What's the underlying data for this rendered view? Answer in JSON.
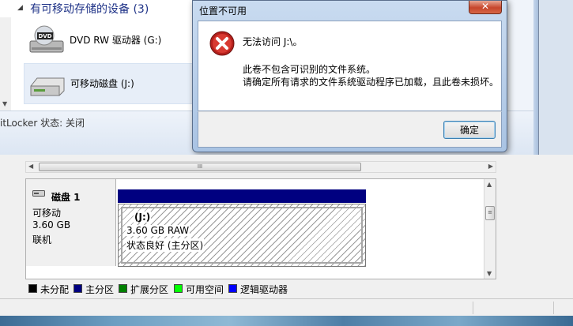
{
  "explorer": {
    "devices_section_title": "有可移动存储的设备 (3)",
    "drives": [
      {
        "label": "DVD RW 驱动器 (G:)",
        "icon": "dvd-drive-icon"
      },
      {
        "label": "可移动磁盘 (J:)",
        "icon": "removable-disk-icon"
      }
    ],
    "details_text": "itLocker 状态: 关闭"
  },
  "dialog": {
    "title": "位置不可用",
    "close_label": "✕",
    "icon": "error-icon",
    "message_title": "无法访问 J:\\。",
    "message_line1": "此卷不包含可识别的文件系统。",
    "message_line2": "请确定所有请求的文件系统驱动程序已加载，且此卷未损坏。",
    "ok_label": "确定"
  },
  "disk": {
    "name": "磁盘 1",
    "type": "可移动",
    "size": "3.60 GB",
    "status": "联机",
    "partition": {
      "letter": "(J:)",
      "size_fs": "3.60 GB RAW",
      "status": "状态良好 (主分区)"
    }
  },
  "hscroll_thumb_label": "III",
  "vscroll_thumb_label": "≡",
  "legend": [
    {
      "label": "未分配",
      "color": "#000000"
    },
    {
      "label": "主分区",
      "color": "#000080"
    },
    {
      "label": "扩展分区",
      "color": "#008000"
    },
    {
      "label": "可用空间",
      "color": "#00ff00"
    },
    {
      "label": "逻辑驱动器",
      "color": "#0000ff"
    }
  ]
}
